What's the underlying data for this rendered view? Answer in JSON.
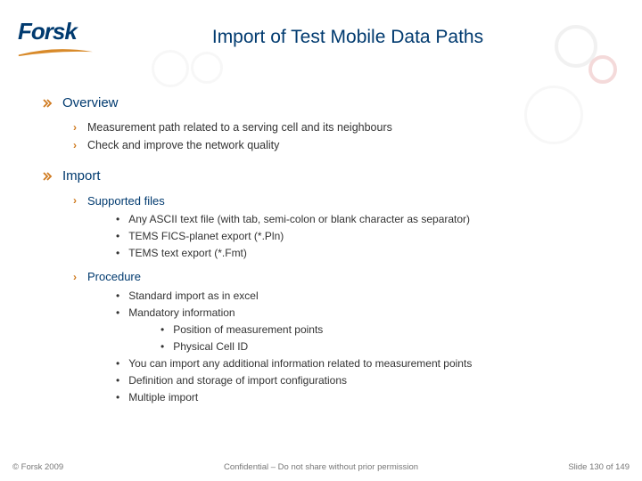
{
  "logo_text": "Forsk",
  "title": "Import of Test Mobile Data Paths",
  "sections": [
    {
      "title": "Overview",
      "items": [
        {
          "text": "Measurement path related to a serving cell and its neighbours"
        },
        {
          "text": "Check and improve the network quality"
        }
      ]
    },
    {
      "title": "Import",
      "subsections": [
        {
          "title": "Supported files",
          "bullets": [
            {
              "text": "Any ASCII text file (with tab, semi-colon or blank character as separator)"
            },
            {
              "text": "TEMS FICS-planet export (*.Pln)"
            },
            {
              "text": "TEMS text export (*.Fmt)"
            }
          ]
        },
        {
          "title": "Procedure",
          "bullets": [
            {
              "text": "Standard import as in excel"
            },
            {
              "text": "Mandatory information",
              "sub": [
                {
                  "text": "Position of measurement points"
                },
                {
                  "text": "Physical Cell ID"
                }
              ]
            },
            {
              "text": "You can import any additional information related to measurement points"
            },
            {
              "text": "Definition and storage of import configurations"
            },
            {
              "text": "Multiple import"
            }
          ]
        }
      ]
    }
  ],
  "footer": {
    "left": "© Forsk 2009",
    "center": "Confidential – Do not share without prior permission",
    "right": "Slide 130 of 149"
  }
}
